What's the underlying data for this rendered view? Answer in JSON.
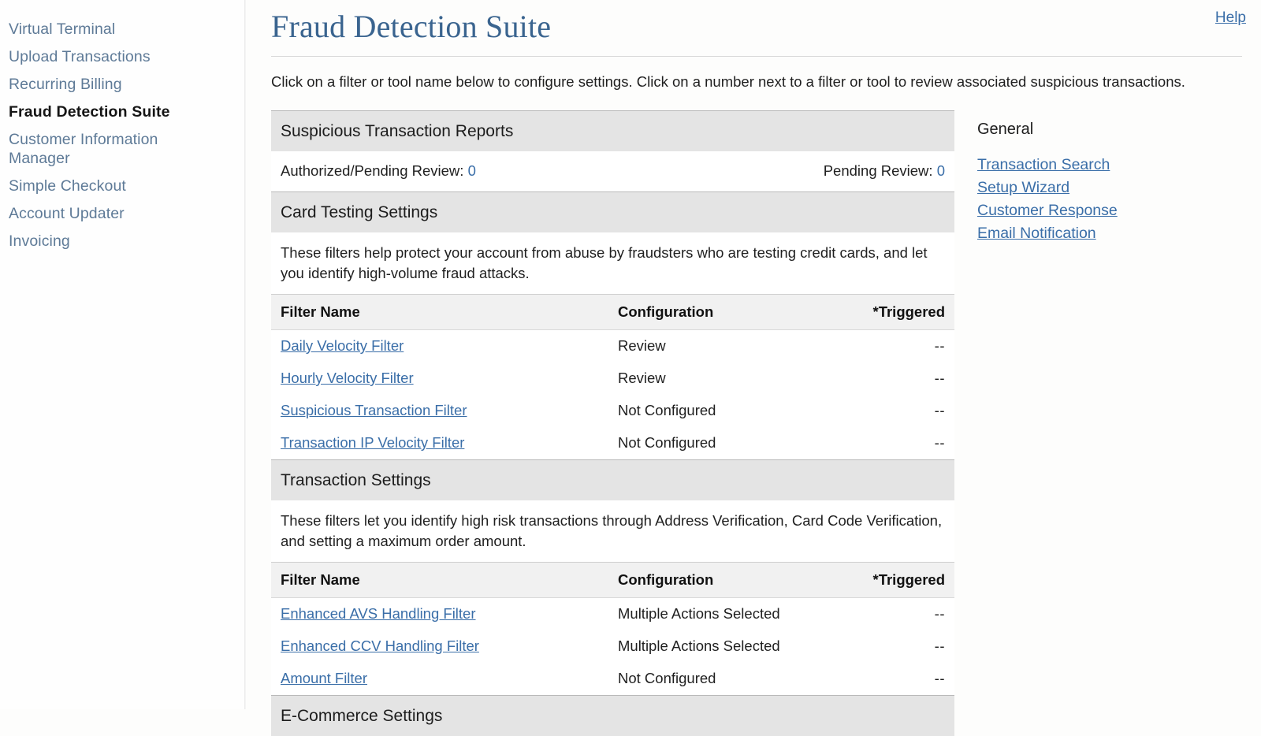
{
  "sidebar": {
    "items": [
      {
        "label": "Virtual Terminal",
        "active": false
      },
      {
        "label": "Upload Transactions",
        "active": false
      },
      {
        "label": "Recurring Billing",
        "active": false
      },
      {
        "label": "Fraud Detection Suite",
        "active": true
      },
      {
        "label": "Customer Information\nManager",
        "active": false
      },
      {
        "label": "Simple Checkout",
        "active": false
      },
      {
        "label": "Account Updater",
        "active": false
      },
      {
        "label": "Invoicing",
        "active": false
      }
    ]
  },
  "header": {
    "title": "Fraud Detection Suite",
    "help_label": "Help",
    "intro": "Click on a filter or tool name below to configure settings. Click on a number next to a filter or tool to review associated suspicious transactions."
  },
  "reports": {
    "section_title": "Suspicious Transaction Reports",
    "authorized_label": "Authorized/Pending Review:",
    "authorized_count": "0",
    "pending_label": "Pending Review:",
    "pending_count": "0"
  },
  "table_headers": {
    "filter_name": "Filter Name",
    "configuration": "Configuration",
    "triggered": "*Triggered"
  },
  "card_testing": {
    "section_title": "Card Testing Settings",
    "description": "These filters help protect your account from abuse by fraudsters who are testing credit cards, and let you identify high-volume fraud attacks.",
    "rows": [
      {
        "name": "Daily Velocity Filter",
        "config": "Review",
        "unset": false,
        "triggered": "--"
      },
      {
        "name": "Hourly Velocity Filter",
        "config": "Review",
        "unset": false,
        "triggered": "--"
      },
      {
        "name": "Suspicious Transaction Filter",
        "config": "Not Configured",
        "unset": true,
        "triggered": "--"
      },
      {
        "name": "Transaction IP Velocity Filter",
        "config": "Not Configured",
        "unset": true,
        "triggered": "--"
      }
    ]
  },
  "transaction_settings": {
    "section_title": "Transaction Settings",
    "description": "These filters let you identify high risk transactions through Address Verification, Card Code Verification, and setting a maximum order amount.",
    "rows": [
      {
        "name": "Enhanced AVS Handling Filter",
        "config": "Multiple Actions Selected",
        "unset": false,
        "triggered": "--"
      },
      {
        "name": "Enhanced CCV Handling Filter",
        "config": "Multiple Actions Selected",
        "unset": false,
        "triggered": "--"
      },
      {
        "name": "Amount Filter",
        "config": "Not Configured",
        "unset": true,
        "triggered": "--"
      }
    ]
  },
  "ecommerce": {
    "section_title": "E-Commerce Settings"
  },
  "general_panel": {
    "heading": "General",
    "links": [
      {
        "label": "Transaction Search"
      },
      {
        "label": "Setup Wizard"
      },
      {
        "label": "Customer Response"
      },
      {
        "label": "Email Notification"
      }
    ]
  },
  "colors": {
    "link": "#3a6ea8",
    "title": "#3a648f",
    "sidebar_link": "#5e7a97",
    "not_configured": "#9a3a38",
    "section_header_bg": "#e4e4e4"
  }
}
